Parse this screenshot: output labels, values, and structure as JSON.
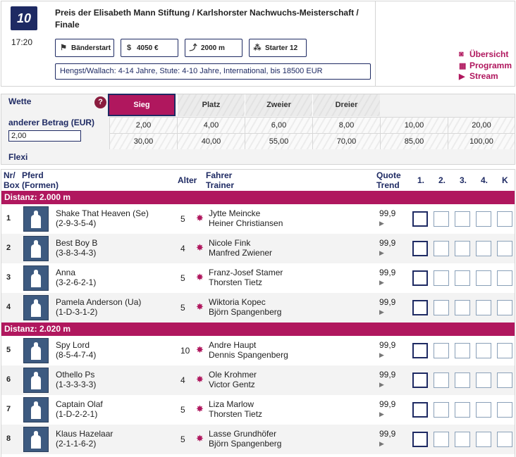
{
  "race": {
    "number": "10",
    "time": "17:20",
    "title": "Preis der Elisabeth Mann Stiftung / Karlshorster Nachwuchs-Meisterschaft / Finale",
    "chips": [
      {
        "icon": "flag-icon",
        "label": "Bänderstart"
      },
      {
        "icon": "money-bag-icon",
        "label": "4050 €"
      },
      {
        "icon": "distance-icon",
        "label": "2000 m"
      },
      {
        "icon": "starters-icon",
        "label": "Starter 12"
      }
    ],
    "info": "Hengst/Wallach: 4-14 Jahre, Stute: 4-10 Jahre, International, bis 18500 EUR"
  },
  "links": [
    {
      "icon": "binoculars-icon",
      "label": "Übersicht"
    },
    {
      "icon": "map-icon",
      "label": "Programm"
    },
    {
      "icon": "play-icon",
      "label": "Stream"
    }
  ],
  "bet": {
    "wette_label": "Wette",
    "help": "?",
    "amount_label": "anderer Betrag (EUR)",
    "amount_value": "2,00",
    "flexi_label": "Flexi",
    "tabs": [
      "Sieg",
      "Platz",
      "Zweier",
      "Dreier"
    ],
    "amounts_row1": [
      "2,00",
      "4,00",
      "6,00",
      "8,00",
      "10,00",
      "20,00"
    ],
    "amounts_row2": [
      "30,00",
      "40,00",
      "55,00",
      "70,00",
      "85,00",
      "100,00"
    ]
  },
  "table": {
    "headers": {
      "nr": "Nr/",
      "box": "Box",
      "pferd": "Pferd",
      "formen": "(Formen)",
      "alter": "Alter",
      "fahrer": "Fahrer",
      "trainer": "Trainer",
      "quote": "Quote",
      "trend": "Trend",
      "c1": "1.",
      "c2": "2.",
      "c3": "3.",
      "c4": "4.",
      "k": "K"
    },
    "groups": [
      {
        "label": "Distanz: 2.000 m",
        "rows": [
          {
            "nr": "1",
            "horse": "Shake That Heaven (Se)",
            "form": "(2-9-3-5-4)",
            "age": "5",
            "driver": "Jytte Meincke",
            "trainer": "Heiner Christiansen",
            "quote": "99,9"
          },
          {
            "nr": "2",
            "horse": "Best Boy B",
            "form": "(3-8-3-4-3)",
            "age": "4",
            "driver": "Nicole Fink",
            "trainer": "Manfred Zwiener",
            "quote": "99,9"
          },
          {
            "nr": "3",
            "horse": "Anna",
            "form": "(3-2-6-2-1)",
            "age": "5",
            "driver": "Franz-Josef Stamer",
            "trainer": "Thorsten Tietz",
            "quote": "99,9"
          },
          {
            "nr": "4",
            "horse": "Pamela Anderson (Ua)",
            "form": "(1-D-3-1-2)",
            "age": "5",
            "driver": "Wiktoria Kopec",
            "trainer": "Björn Spangenberg",
            "quote": "99,9"
          }
        ]
      },
      {
        "label": "Distanz: 2.020 m",
        "rows": [
          {
            "nr": "5",
            "horse": "Spy Lord",
            "form": "(8-5-4-7-4)",
            "age": "10",
            "driver": "Andre Haupt",
            "trainer": "Dennis Spangenberg",
            "quote": "99,9"
          },
          {
            "nr": "6",
            "horse": "Othello Ps",
            "form": "(1-3-3-3-3)",
            "age": "4",
            "driver": "Ole Krohmer",
            "trainer": "Victor Gentz",
            "quote": "99,9"
          },
          {
            "nr": "7",
            "horse": "Captain Olaf",
            "form": "(1-D-2-2-1)",
            "age": "5",
            "driver": "Liza Marlow",
            "trainer": "Thorsten Tietz",
            "quote": "99,9"
          },
          {
            "nr": "8",
            "horse": "Klaus Hazelaar",
            "form": "(2-1-1-6-2)",
            "age": "5",
            "driver": "Lasse Grundhöfer",
            "trainer": "Björn Spangenberg",
            "quote": "99,9"
          }
        ]
      }
    ]
  },
  "colors": {
    "navy": "#1e2a63",
    "accent": "#b0175e"
  }
}
